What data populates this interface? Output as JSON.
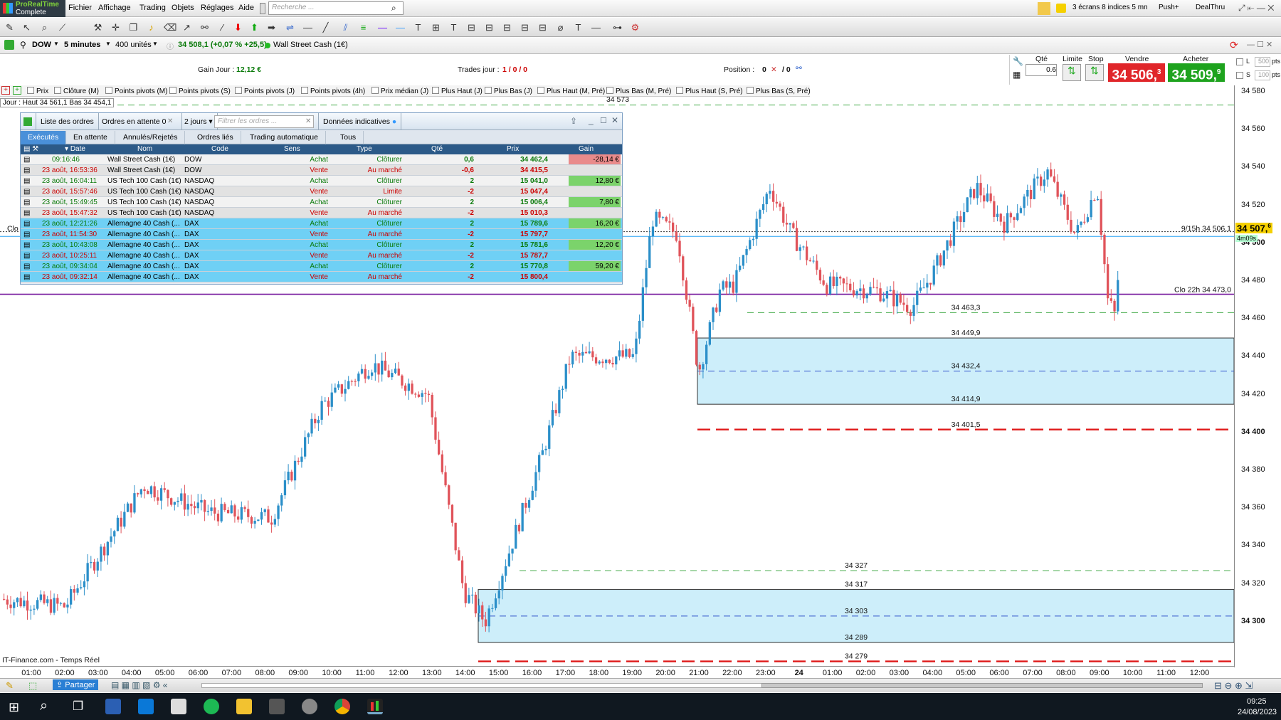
{
  "app": {
    "name": "ProRealTime",
    "edition": "Complete"
  },
  "menu": [
    "Fichier",
    "Affichage",
    "Trading",
    "Objets",
    "Réglages",
    "Aide"
  ],
  "search": {
    "placeholder": "Recherche ..."
  },
  "topright": {
    "screens": "3 écrans 8 indices 5 mn",
    "push": "Push+",
    "dealthru": "DealThru"
  },
  "instrument": {
    "ticker": "DOW",
    "timeframe": "5 minutes",
    "units": "400 unités",
    "quote": "34 508,1 (+0,07 % +25,5)",
    "name": "Wall Street Cash (1€)"
  },
  "infobar": {
    "gain_label": "Gain Jour :",
    "gain_value": "12,12 €",
    "trades_label": "Trades jour :",
    "trades_value": "1 / 0 / 0",
    "position_label": "Position :",
    "position_value": "0",
    "position_rest": "/ 0",
    "qty_label": "Qté",
    "qty_value": "0.6",
    "limit_label": "Limite",
    "stop_label": "Stop",
    "sell_label": "Vendre",
    "sell_price": "34 506,",
    "sell_sup": "3",
    "buy_label": "Acheter",
    "buy_price": "34 509,",
    "buy_sup": "9",
    "l_label": "L",
    "l_val": "500",
    "s_label": "S",
    "s_val": "100",
    "pts": "pts"
  },
  "indicators": [
    "Prix",
    "Clôture (M)",
    "Points pivots (M)",
    "Points pivots (S)",
    "Points pivots (J)",
    "Points pivots (4h)",
    "Prix médian (J)",
    "Plus Haut (J)",
    "Plus Bas (J)",
    "Plus Haut (M, Pré)",
    "Plus Bas (M, Pré)",
    "Plus Haut (S, Pré)",
    "Plus Bas (S, Pré)"
  ],
  "jour_label": "Jour : Haut 34 561,1 Bas 34 454,1",
  "orders": {
    "title": "Liste des ordres",
    "pending": "Ordres en attente",
    "pending_count": "0",
    "period": "2 jours",
    "filter_placeholder": "Filtrer les ordres ...",
    "indicative": "Données indicatives",
    "tabs": [
      "Exécutés",
      "En attente",
      "Annulés/Rejetés",
      "Ordres liés",
      "Trading automatique",
      "Tous"
    ],
    "headers": [
      "Date",
      "Nom",
      "Code",
      "Sens",
      "Type",
      "Qté",
      "Prix",
      "Gain"
    ],
    "rows": [
      {
        "date": "09:16:46",
        "nom": "Wall Street Cash (1€)",
        "code": "DOW",
        "sens": "Achat",
        "type": "Clôturer",
        "qte": "0,6",
        "prix": "34 462,4",
        "gain": "-28,14 €"
      },
      {
        "date": "23 août, 16:53:36",
        "nom": "Wall Street Cash (1€)",
        "code": "DOW",
        "sens": "Vente",
        "type": "Au marché",
        "qte": "-0,6",
        "prix": "34 415,5",
        "gain": ""
      },
      {
        "date": "23 août, 16:04:11",
        "nom": "US Tech 100 Cash (1€)",
        "code": "NASDAQ",
        "sens": "Achat",
        "type": "Clôturer",
        "qte": "2",
        "prix": "15 041,0",
        "gain": "12,80 €"
      },
      {
        "date": "23 août, 15:57:46",
        "nom": "US Tech 100 Cash (1€)",
        "code": "NASDAQ",
        "sens": "Vente",
        "type": "Limite",
        "qte": "-2",
        "prix": "15 047,4",
        "gain": ""
      },
      {
        "date": "23 août, 15:49:45",
        "nom": "US Tech 100 Cash (1€)",
        "code": "NASDAQ",
        "sens": "Achat",
        "type": "Clôturer",
        "qte": "2",
        "prix": "15 006,4",
        "gain": "7,80 €"
      },
      {
        "date": "23 août, 15:47:32",
        "nom": "US Tech 100 Cash (1€)",
        "code": "NASDAQ",
        "sens": "Vente",
        "type": "Au marché",
        "qte": "-2",
        "prix": "15 010,3",
        "gain": ""
      },
      {
        "date": "23 août, 12:21:26",
        "nom": "Allemagne 40 Cash (...",
        "code": "DAX",
        "sens": "Achat",
        "type": "Clôturer",
        "qte": "2",
        "prix": "15 789,6",
        "gain": "16,20 €"
      },
      {
        "date": "23 août, 11:54:30",
        "nom": "Allemagne 40 Cash (...",
        "code": "DAX",
        "sens": "Vente",
        "type": "Au marché",
        "qte": "-2",
        "prix": "15 797,7",
        "gain": ""
      },
      {
        "date": "23 août, 10:43:08",
        "nom": "Allemagne 40 Cash (...",
        "code": "DAX",
        "sens": "Achat",
        "type": "Clôturer",
        "qte": "2",
        "prix": "15 781,6",
        "gain": "12,20 €"
      },
      {
        "date": "23 août, 10:25:11",
        "nom": "Allemagne 40 Cash (...",
        "code": "DAX",
        "sens": "Vente",
        "type": "Au marché",
        "qte": "-2",
        "prix": "15 787,7",
        "gain": ""
      },
      {
        "date": "23 août, 09:34:04",
        "nom": "Allemagne 40 Cash (...",
        "code": "DAX",
        "sens": "Achat",
        "type": "Clôturer",
        "qte": "2",
        "prix": "15 770,8",
        "gain": "59,20 €"
      },
      {
        "date": "23 août, 09:32:14",
        "nom": "Allemagne 40 Cash (...",
        "code": "DAX",
        "sens": "Vente",
        "type": "Au marché",
        "qte": "-2",
        "prix": "15 800,4",
        "gain": ""
      }
    ]
  },
  "chart_data": {
    "type": "candlestick",
    "y_ticks": [
      "34 580",
      "34 560",
      "34 540",
      "34 520",
      "34 500",
      "34 480",
      "34 460",
      "34 440",
      "34 420",
      "34 400",
      "34 380",
      "34 360",
      "34 340",
      "34 320",
      "34 300"
    ],
    "ylim": [
      34296,
      34581
    ],
    "x_ticks": [
      "01:00",
      "02:00",
      "03:00",
      "04:00",
      "05:00",
      "06:00",
      "07:00",
      "08:00",
      "09:00",
      "10:00",
      "11:00",
      "12:00",
      "13:00",
      "14:00",
      "15:00",
      "16:00",
      "17:00",
      "18:00",
      "19:00",
      "20:00",
      "21:00",
      "22:00",
      "23:00",
      "24",
      "01:00",
      "02:00",
      "03:00",
      "04:00",
      "05:00",
      "06:00",
      "07:00",
      "08:00",
      "09:00",
      "10:00",
      "11:00",
      "12:00"
    ],
    "current_price": "34 507,",
    "current_price_sup": "6",
    "countdown": "4m09s",
    "cursor_label": "9/15h 34 506,1",
    "close_label": "Clo 22h 34 473,0",
    "level_labels": [
      "34 573",
      "34 463,3",
      "34 449,9",
      "34 432,4",
      "34 414,9",
      "34 401,5",
      "34 327",
      "34 317",
      "34 303",
      "34 289",
      "34 279"
    ],
    "source": "IT-Finance.com - Temps Réel",
    "clo_left": "Clo"
  },
  "bottombar": {
    "share": "Partager"
  },
  "taskbar": {
    "time": "09:25",
    "date": "24/08/2023"
  }
}
